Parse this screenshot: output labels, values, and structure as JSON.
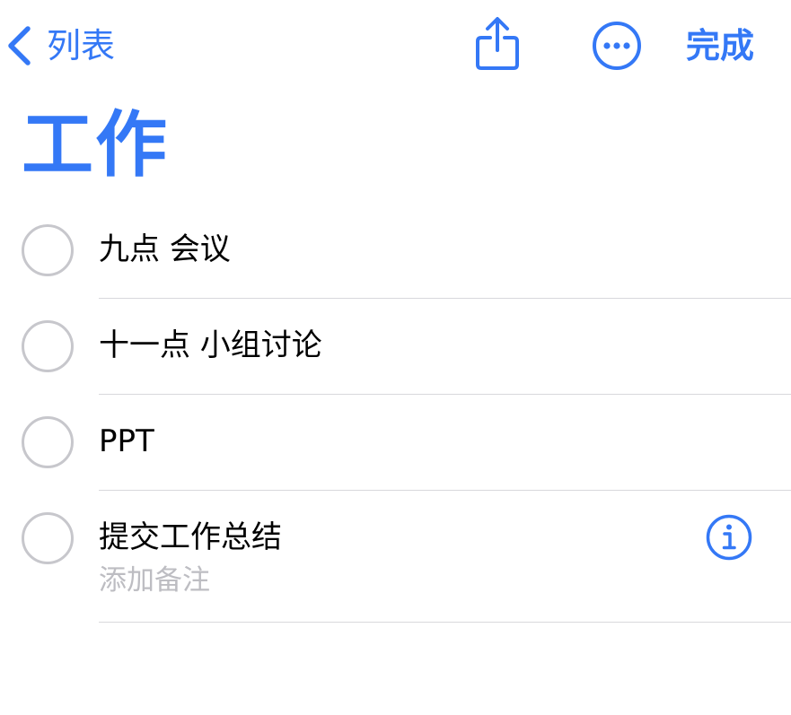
{
  "navbar": {
    "back_label": "列表",
    "done_label": "完成"
  },
  "list_title": "工作",
  "items": [
    {
      "title": "九点 会议"
    },
    {
      "title": "十一点 小组讨论"
    },
    {
      "title": "PPT"
    },
    {
      "title": "提交工作总结",
      "note_placeholder": "添加备注"
    }
  ],
  "colors": {
    "accent": "#3478F6",
    "checkbox_border": "#C7C7CC",
    "separator": "#D8D8DC",
    "placeholder": "#BDBDC2"
  },
  "icons": {
    "back": "chevron-left-icon",
    "share": "share-icon",
    "more": "ellipsis-circle-icon",
    "info": "info-circle-icon"
  }
}
